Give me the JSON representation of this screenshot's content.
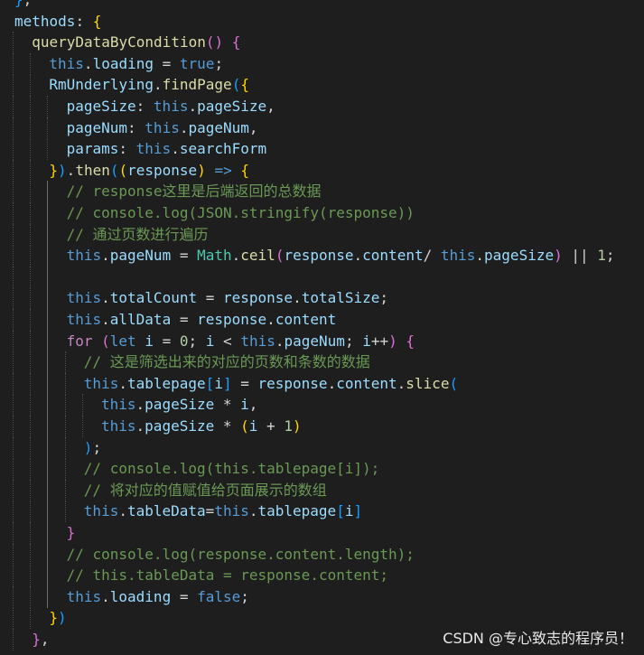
{
  "colors": {
    "background": "#1e1e1e",
    "keyword": "#569cd6",
    "control": "#c586c0",
    "function": "#dcdcaa",
    "variable": "#9cdcfe",
    "number": "#b5cea8",
    "class": "#4ec9b0",
    "comment": "#6a9955",
    "bracket_gold": "#ffd700",
    "bracket_orchid": "#da70d6",
    "bracket_blue": "#179fff"
  },
  "editor": {
    "lines": [
      {
        "indent": 0,
        "tokens": [
          [
            "p3",
            "}"
          ],
          [
            "op",
            ","
          ]
        ]
      },
      {
        "indent": 0,
        "tokens": [
          [
            "var",
            "methods"
          ],
          [
            "op",
            ": "
          ],
          [
            "p1",
            "{"
          ]
        ]
      },
      {
        "indent": 1,
        "tokens": [
          [
            "fn",
            "queryDataByCondition"
          ],
          [
            "p2",
            "()"
          ],
          [
            "op",
            " "
          ],
          [
            "p2",
            "{"
          ]
        ]
      },
      {
        "indent": 2,
        "tokens": [
          [
            "kw",
            "this"
          ],
          [
            "op",
            "."
          ],
          [
            "prop",
            "loading"
          ],
          [
            "op",
            " = "
          ],
          [
            "kw",
            "true"
          ],
          [
            "op",
            ";"
          ]
        ]
      },
      {
        "indent": 2,
        "tokens": [
          [
            "var",
            "RmUnderlying"
          ],
          [
            "op",
            "."
          ],
          [
            "fn",
            "findPage"
          ],
          [
            "p3",
            "("
          ],
          [
            "p1",
            "{"
          ]
        ]
      },
      {
        "indent": 3,
        "tokens": [
          [
            "prop",
            "pageSize"
          ],
          [
            "op",
            ": "
          ],
          [
            "kw",
            "this"
          ],
          [
            "op",
            "."
          ],
          [
            "prop",
            "pageSize"
          ],
          [
            "op",
            ","
          ]
        ]
      },
      {
        "indent": 3,
        "tokens": [
          [
            "prop",
            "pageNum"
          ],
          [
            "op",
            ": "
          ],
          [
            "kw",
            "this"
          ],
          [
            "op",
            "."
          ],
          [
            "prop",
            "pageNum"
          ],
          [
            "op",
            ","
          ]
        ]
      },
      {
        "indent": 3,
        "tokens": [
          [
            "prop",
            "params"
          ],
          [
            "op",
            ": "
          ],
          [
            "kw",
            "this"
          ],
          [
            "op",
            "."
          ],
          [
            "prop",
            "searchForm"
          ]
        ]
      },
      {
        "indent": 2,
        "tokens": [
          [
            "p1",
            "}"
          ],
          [
            "p3",
            ")"
          ],
          [
            "op",
            "."
          ],
          [
            "fn",
            "then"
          ],
          [
            "p3",
            "("
          ],
          [
            "p1",
            "("
          ],
          [
            "var",
            "response"
          ],
          [
            "p1",
            ")"
          ],
          [
            "op",
            " "
          ],
          [
            "kw",
            "=>"
          ],
          [
            "op",
            " "
          ],
          [
            "p1",
            "{"
          ]
        ]
      },
      {
        "indent": 3,
        "tokens": [
          [
            "cm",
            "// response这里是后端返回的总数据"
          ]
        ]
      },
      {
        "indent": 3,
        "tokens": [
          [
            "cm",
            "// console.log(JSON.stringify(response))"
          ]
        ]
      },
      {
        "indent": 3,
        "tokens": [
          [
            "cm",
            "// 通过页数进行遍历"
          ]
        ]
      },
      {
        "indent": 3,
        "tokens": [
          [
            "kw",
            "this"
          ],
          [
            "op",
            "."
          ],
          [
            "prop",
            "pageNum"
          ],
          [
            "op",
            " = "
          ],
          [
            "cls",
            "Math"
          ],
          [
            "op",
            "."
          ],
          [
            "fn",
            "ceil"
          ],
          [
            "p2",
            "("
          ],
          [
            "var",
            "response"
          ],
          [
            "op",
            "."
          ],
          [
            "prop",
            "content"
          ],
          [
            "op",
            "/ "
          ],
          [
            "kw",
            "this"
          ],
          [
            "op",
            "."
          ],
          [
            "prop",
            "pageSize"
          ],
          [
            "p2",
            ")"
          ],
          [
            "op",
            " || "
          ],
          [
            "num",
            "1"
          ],
          [
            "op",
            ";"
          ]
        ]
      },
      {
        "indent": 3,
        "tokens": []
      },
      {
        "indent": 3,
        "tokens": [
          [
            "kw",
            "this"
          ],
          [
            "op",
            "."
          ],
          [
            "prop",
            "totalCount"
          ],
          [
            "op",
            " = "
          ],
          [
            "var",
            "response"
          ],
          [
            "op",
            "."
          ],
          [
            "prop",
            "totalSize"
          ],
          [
            "op",
            ";"
          ]
        ]
      },
      {
        "indent": 3,
        "tokens": [
          [
            "kw",
            "this"
          ],
          [
            "op",
            "."
          ],
          [
            "prop",
            "allData"
          ],
          [
            "op",
            " = "
          ],
          [
            "var",
            "response"
          ],
          [
            "op",
            "."
          ],
          [
            "prop",
            "content"
          ]
        ]
      },
      {
        "indent": 3,
        "tokens": [
          [
            "ctl",
            "for"
          ],
          [
            "op",
            " "
          ],
          [
            "p2",
            "("
          ],
          [
            "kw",
            "let"
          ],
          [
            "op",
            " "
          ],
          [
            "var",
            "i"
          ],
          [
            "op",
            " = "
          ],
          [
            "num",
            "0"
          ],
          [
            "op",
            "; "
          ],
          [
            "var",
            "i"
          ],
          [
            "op",
            " < "
          ],
          [
            "kw",
            "this"
          ],
          [
            "op",
            "."
          ],
          [
            "prop",
            "pageNum"
          ],
          [
            "op",
            "; "
          ],
          [
            "var",
            "i"
          ],
          [
            "op",
            "++"
          ],
          [
            "p2",
            ")"
          ],
          [
            "op",
            " "
          ],
          [
            "p2",
            "{"
          ]
        ]
      },
      {
        "indent": 4,
        "tokens": [
          [
            "cm",
            "// 这是筛选出来的对应的页数和条数的数据"
          ]
        ]
      },
      {
        "indent": 4,
        "tokens": [
          [
            "kw",
            "this"
          ],
          [
            "op",
            "."
          ],
          [
            "prop",
            "tablepage"
          ],
          [
            "p3",
            "["
          ],
          [
            "var",
            "i"
          ],
          [
            "p3",
            "]"
          ],
          [
            "op",
            " = "
          ],
          [
            "var",
            "response"
          ],
          [
            "op",
            "."
          ],
          [
            "prop",
            "content"
          ],
          [
            "op",
            "."
          ],
          [
            "fn",
            "slice"
          ],
          [
            "p3",
            "("
          ]
        ]
      },
      {
        "indent": 5,
        "tokens": [
          [
            "kw",
            "this"
          ],
          [
            "op",
            "."
          ],
          [
            "prop",
            "pageSize"
          ],
          [
            "op",
            " * "
          ],
          [
            "var",
            "i"
          ],
          [
            "op",
            ","
          ]
        ]
      },
      {
        "indent": 5,
        "tokens": [
          [
            "kw",
            "this"
          ],
          [
            "op",
            "."
          ],
          [
            "prop",
            "pageSize"
          ],
          [
            "op",
            " * "
          ],
          [
            "p1",
            "("
          ],
          [
            "var",
            "i"
          ],
          [
            "op",
            " + "
          ],
          [
            "num",
            "1"
          ],
          [
            "p1",
            ")"
          ]
        ]
      },
      {
        "indent": 4,
        "tokens": [
          [
            "p3",
            ")"
          ],
          [
            "op",
            ";"
          ]
        ]
      },
      {
        "indent": 4,
        "tokens": [
          [
            "cm",
            "// console.log(this.tablepage[i]);"
          ]
        ]
      },
      {
        "indent": 4,
        "tokens": [
          [
            "cm",
            "// 将对应的值赋值给页面展示的数组"
          ]
        ]
      },
      {
        "indent": 4,
        "tokens": [
          [
            "kw",
            "this"
          ],
          [
            "op",
            "."
          ],
          [
            "prop",
            "tableData"
          ],
          [
            "op",
            "="
          ],
          [
            "kw",
            "this"
          ],
          [
            "op",
            "."
          ],
          [
            "prop",
            "tablepage"
          ],
          [
            "p3",
            "["
          ],
          [
            "var",
            "i"
          ],
          [
            "p3",
            "]"
          ]
        ]
      },
      {
        "indent": 3,
        "tokens": [
          [
            "p2",
            "}"
          ]
        ]
      },
      {
        "indent": 3,
        "tokens": [
          [
            "cm",
            "// console.log(response.content.length);"
          ]
        ]
      },
      {
        "indent": 3,
        "tokens": [
          [
            "cm",
            "// this.tableData = response.content;"
          ]
        ]
      },
      {
        "indent": 3,
        "tokens": [
          [
            "kw",
            "this"
          ],
          [
            "op",
            "."
          ],
          [
            "prop",
            "loading"
          ],
          [
            "op",
            " = "
          ],
          [
            "kw",
            "false"
          ],
          [
            "op",
            ";"
          ]
        ]
      },
      {
        "indent": 2,
        "tokens": [
          [
            "p1",
            "}"
          ],
          [
            "p3",
            ")"
          ]
        ]
      },
      {
        "indent": 1,
        "tokens": [
          [
            "p2",
            "}"
          ],
          [
            "op",
            ","
          ]
        ]
      }
    ]
  },
  "watermark": "CSDN @专心致志的程序员！"
}
